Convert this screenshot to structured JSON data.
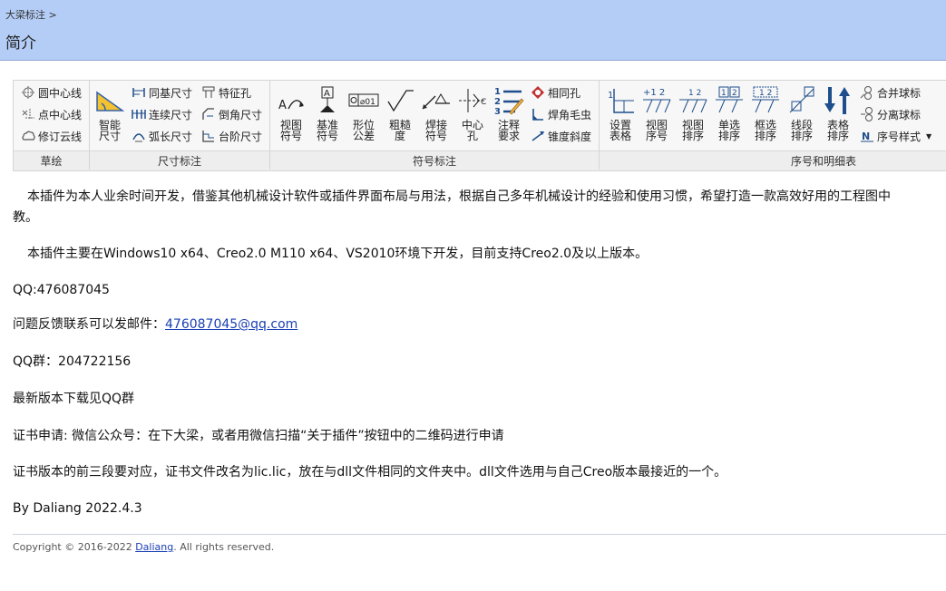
{
  "header": {
    "breadcrumb": "大梁标注 >",
    "title": "简介"
  },
  "ribbon": {
    "groups": [
      {
        "label": "草绘"
      },
      {
        "label": "尺寸标注"
      },
      {
        "label": "符号标注"
      },
      {
        "label": "序号和明细表"
      }
    ],
    "sketch": [
      "圆中心线",
      "点中心线",
      "修订云线"
    ],
    "smart": {
      "l1": "智能",
      "l2": "尺寸"
    },
    "dim_col1": [
      "同基尺寸",
      "连续尺寸",
      "弧长尺寸"
    ],
    "dim_col2": [
      "特征孔",
      "倒角尺寸",
      "台阶尺寸"
    ],
    "symbols": [
      {
        "l1": "视图",
        "l2": "符号",
        "icon": "view-symbol-icon"
      },
      {
        "l1": "基准",
        "l2": "符号",
        "icon": "datum-symbol-icon"
      },
      {
        "l1": "形位",
        "l2": "公差",
        "icon": "gtol-icon"
      },
      {
        "l1": "粗糙",
        "l2": "度",
        "icon": "roughness-icon"
      },
      {
        "l1": "焊接",
        "l2": "符号",
        "icon": "weld-symbol-icon"
      },
      {
        "l1": "中心",
        "l2": "孔",
        "icon": "center-hole-icon"
      },
      {
        "l1": "注释",
        "l2": "要求",
        "icon": "note-requirement-icon"
      }
    ],
    "symbol_small": [
      "相同孔",
      "焊角毛虫",
      "锥度斜度"
    ],
    "bom": [
      {
        "l1": "设置",
        "l2": "表格",
        "icon": "set-table-icon"
      },
      {
        "l1": "视图",
        "l2": "序号",
        "icon": "view-number-icon"
      },
      {
        "l1": "视图",
        "l2": "排序",
        "icon": "view-sort-icon"
      },
      {
        "l1": "单选",
        "l2": "排序",
        "icon": "single-sort-icon"
      },
      {
        "l1": "框选",
        "l2": "排序",
        "icon": "box-sort-icon"
      },
      {
        "l1": "线段",
        "l2": "排序",
        "icon": "segment-sort-icon"
      },
      {
        "l1": "表格",
        "l2": "排序",
        "icon": "table-sort-icon"
      }
    ],
    "bom_small": [
      "合并球标",
      "分离球标",
      "序号样式"
    ]
  },
  "content": {
    "intro1": "本插件为本人业余时间开发，借鉴其他机械设计软件或插件界面布局与用法，根据自己多年机械设计的经验和使用习惯，希望打造一款高效好用的工程图中",
    "intro1b": "教。",
    "intro2": "本插件主要在Windows10 x64、Creo2.0 M110 x64、VS2010环境下开发，目前支持Creo2.0及以上版本。",
    "qq": "QQ:476087045",
    "feedback_label": "问题反馈联系可以发邮件：",
    "email": "476087045@qq.com",
    "qq_group": "QQ群：204722156",
    "latest": "最新版本下载见QQ群",
    "cert_apply": "证书申请: 微信公众号：在下大梁，或者用微信扫描“关于插件”按钮中的二维码进行申请",
    "cert_version": "证书版本的前三段要对应，证书文件改名为lic.lic，放在与dll文件相同的文件夹中。dll文件选用与自己Creo版本最接近的一个。",
    "author": "By Daliang 2022.4.3"
  },
  "footer": {
    "copyright": "Copyright © 2016-2022",
    "link": "Daliang",
    "rights": ". All rights reserved."
  },
  "colors": {
    "header_bg": "#b4cdf7",
    "link": "#1a3fb3",
    "icon_blue": "#1e4e8c"
  }
}
